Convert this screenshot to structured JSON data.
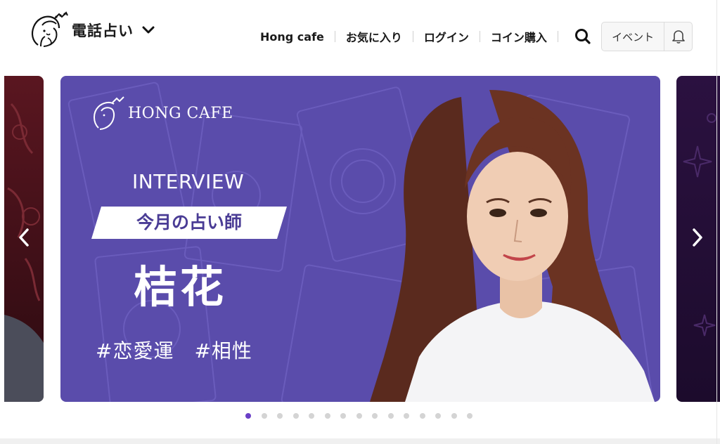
{
  "header": {
    "title": "電話占い",
    "nav": [
      "Hong cafe",
      "お気に入り",
      "ログイン",
      "コイン購入"
    ],
    "event_label": "イベント"
  },
  "banner": {
    "brand": "HONG CAFE",
    "kicker": "INTERVIEW",
    "tag": "今月の占い師",
    "name": "桔花",
    "hashtags": "#恋愛運　#相性"
  },
  "carousel": {
    "slide_count": 15,
    "active_index": 0
  },
  "colors": {
    "accent": "#6a3fc7",
    "banner_bg": "#5a4cab",
    "tag_text": "#4a3c95"
  }
}
